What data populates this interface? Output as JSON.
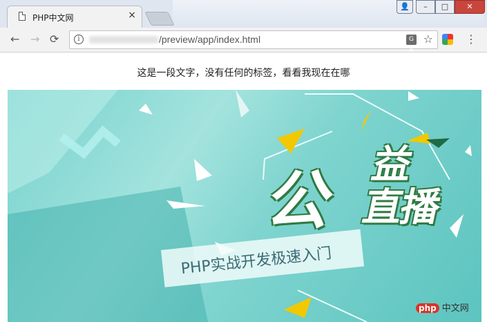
{
  "browser": {
    "tab": {
      "title": "PHP中文网",
      "close": "×"
    },
    "window_controls": {
      "user": "👤",
      "minimize": "–",
      "maximize": "□",
      "close": "✕"
    },
    "toolbar": {
      "back": "←",
      "forward": "→",
      "reload": "⟳",
      "info": "i",
      "url": "/preview/app/index.html",
      "translate": "G文",
      "star": "☆",
      "menu": "⋮"
    },
    "icons": [
      "page-icon",
      "info-icon",
      "translate-icon",
      "star-icon",
      "extension-icon",
      "menu-icon"
    ]
  },
  "page": {
    "text": "这是一段文字，没有任何的标签，看看我现在在哪",
    "banner": {
      "title_main": "公",
      "title_side": "益\n直播",
      "ribbon": "PHP实战开发极速入门"
    }
  },
  "watermark": {
    "logo": "php",
    "label": "中文网"
  },
  "colors": {
    "banner_teal": "#7fd4cf",
    "outline_green": "#2f7b43",
    "accent_yellow": "#f2c800",
    "close_red": "#c9463c"
  }
}
